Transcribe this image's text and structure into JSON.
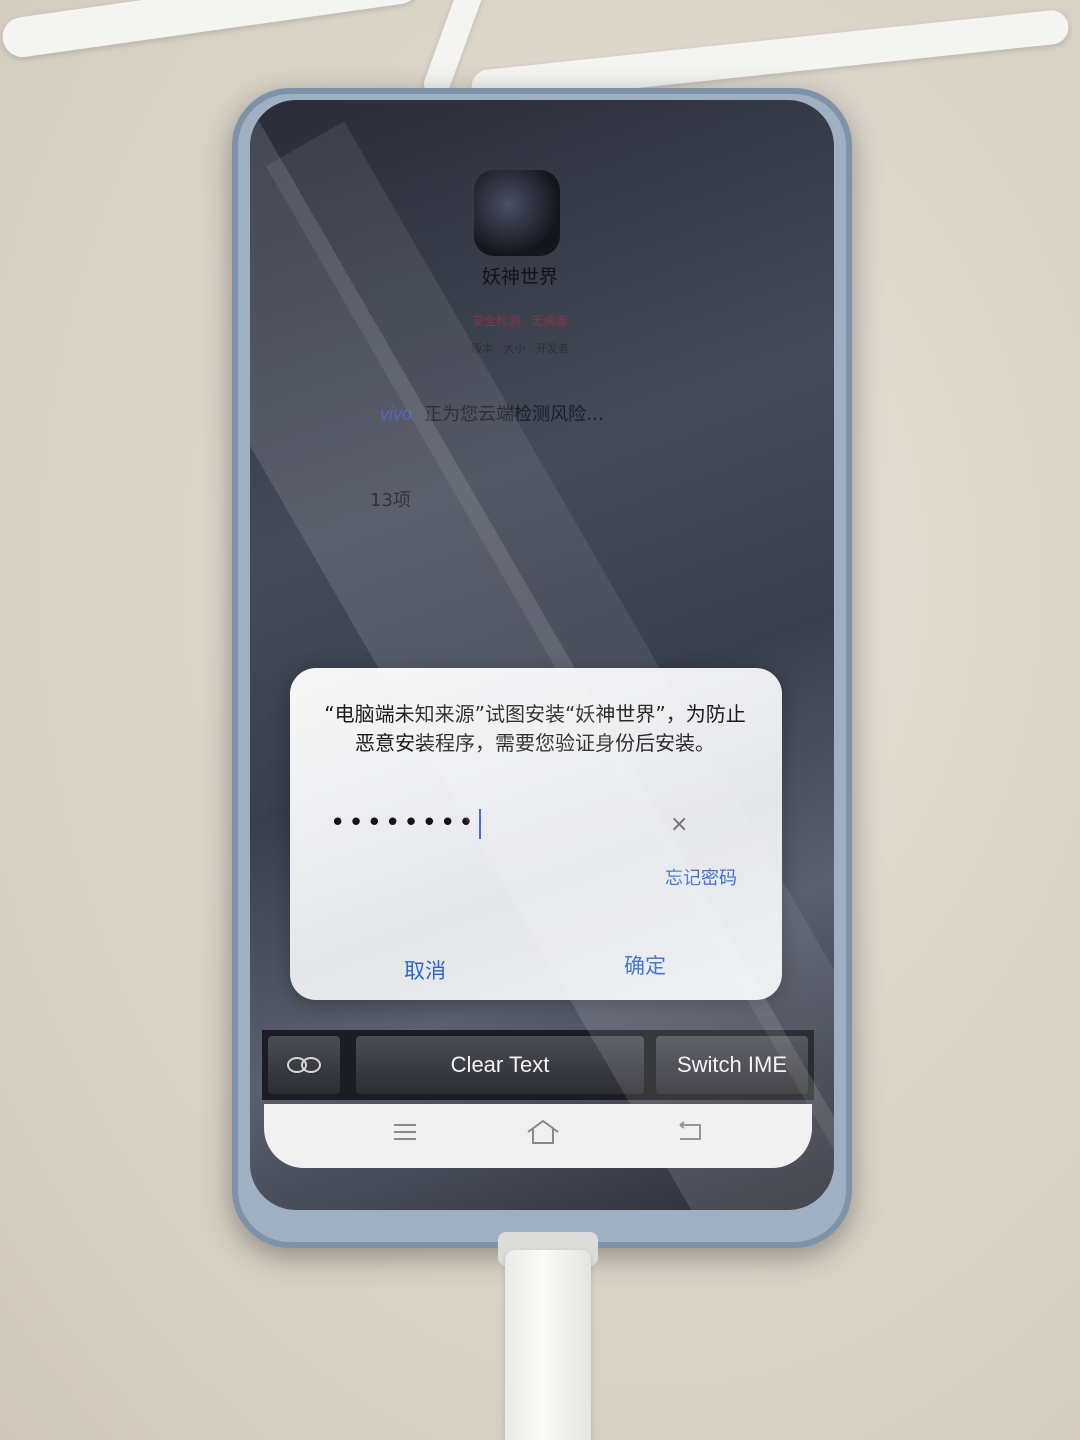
{
  "app": {
    "name": "妖神世界",
    "tags": "安全检测 · 无病毒",
    "meta": "版本 · 大小 · 开发者"
  },
  "scan": {
    "brand": "vivo",
    "status": "正为您云端检测风险…",
    "count": "13项"
  },
  "dialog": {
    "message": "“电脑端未知来源”试图安装“妖神世界”，为防止恶意安装程序，需要您验证身份后安装。",
    "password_masked": "••••••••",
    "clear_icon": "×",
    "forgot_password": "忘记密码",
    "cancel": "取消",
    "confirm": "确定"
  },
  "ime": {
    "loop_icon": "infinity-icon",
    "clear_text": "Clear Text",
    "switch_ime": "Switch IME"
  },
  "navbar": {
    "menu_icon": "menu-icon",
    "home_icon": "home-icon",
    "back_icon": "back-icon"
  },
  "colors": {
    "accent": "#2d66c9",
    "dialog_bg": "#ececec",
    "ime_bar": "#1c1d22"
  }
}
